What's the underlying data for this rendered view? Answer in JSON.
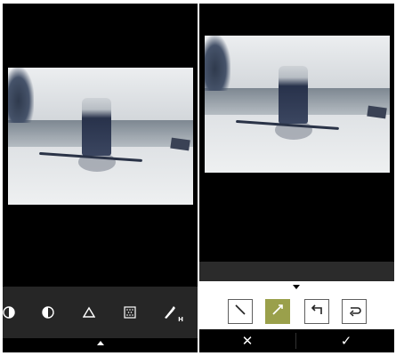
{
  "left_screen": {
    "toolbar": {
      "tools": [
        {
          "icon": "half-circle-icon"
        },
        {
          "icon": "contrast-icon"
        },
        {
          "icon": "triangle-icon"
        },
        {
          "icon": "grain-icon"
        },
        {
          "icon": "brush-h-icon",
          "badge": "H"
        }
      ]
    }
  },
  "right_screen": {
    "options": [
      {
        "icon": "diagonal-line-icon",
        "selected": false
      },
      {
        "icon": "diagonal-line-arrow-icon",
        "selected": true
      },
      {
        "icon": "undo-icon",
        "selected": false
      },
      {
        "icon": "redo-icon",
        "selected": false
      }
    ],
    "cancel_glyph": "✕",
    "confirm_glyph": "✓",
    "accent_color": "#9aa04b"
  }
}
